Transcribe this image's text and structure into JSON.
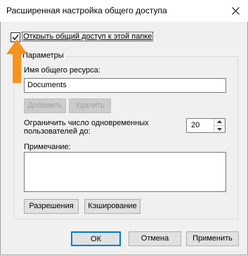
{
  "window": {
    "title": "Расширенная настройка общего доступа",
    "close_icon": "close-icon"
  },
  "share_checkbox": {
    "label": "Открыть общий доступ к этой папке",
    "checked": true
  },
  "params_group": {
    "label": "Параметры",
    "share_name_label": "Имя общего ресурса:",
    "share_name_value": "Documents",
    "add_label": "Добавить",
    "remove_label": "Удалить",
    "limit_label_line1": "Ограничить число одновременных",
    "limit_label_line2": "пользователей до:",
    "limit_value": "20",
    "note_label": "Примечание:",
    "note_value": "",
    "permissions_label": "Разрешения",
    "caching_label": "Кэширование"
  },
  "footer": {
    "ok_label": "ОК",
    "cancel_label": "Отмена",
    "apply_label": "Применить"
  },
  "annotation": {
    "arrow_color": "#f7931e",
    "icon": "up-arrow-icon"
  }
}
